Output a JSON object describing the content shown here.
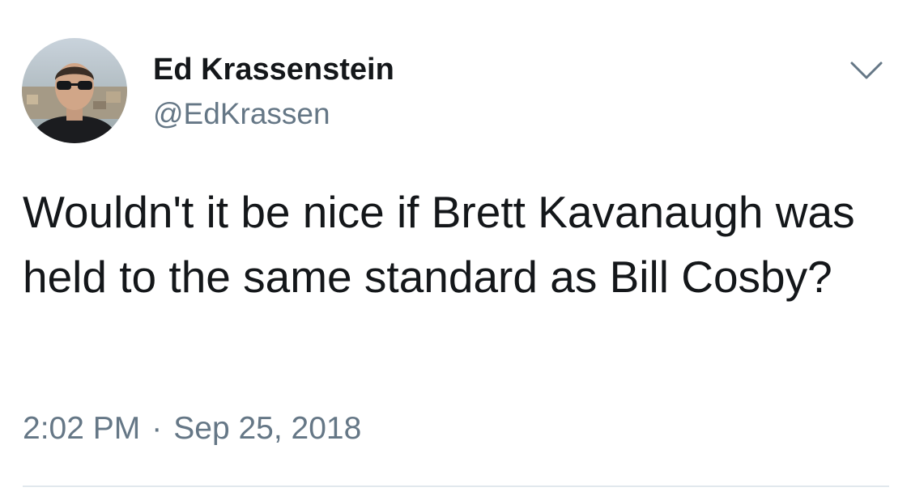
{
  "tweet": {
    "author": {
      "display_name": "Ed Krassenstein",
      "handle": "@EdKrassen",
      "avatar_icon": "profile-photo"
    },
    "menu_icon": "chevron-down-icon",
    "text": "Wouldn't it be nice if Brett Kavanaugh was held to the same standard as Bill Cosby?",
    "time": "2:02 PM",
    "separator": "·",
    "date": "Sep 25, 2018"
  },
  "colors": {
    "primary_text": "#14171a",
    "secondary_text": "#657786",
    "divider": "#e1e8ed",
    "background": "#ffffff"
  }
}
